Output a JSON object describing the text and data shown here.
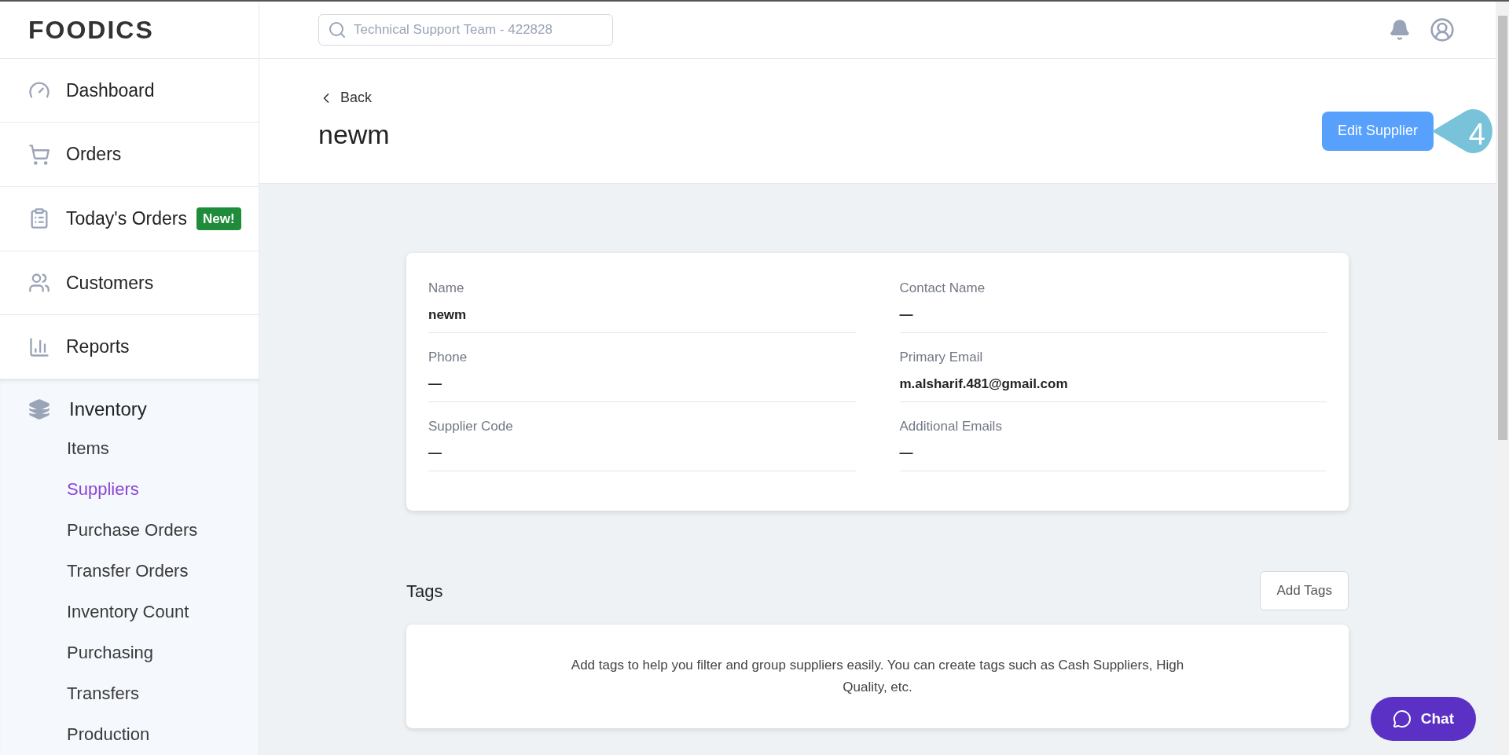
{
  "logo": "FOODICS",
  "search": {
    "placeholder": "Technical Support Team - 422828"
  },
  "nav": [
    {
      "label": "Dashboard"
    },
    {
      "label": "Orders"
    },
    {
      "label": "Today's Orders",
      "badge": "New!"
    },
    {
      "label": "Customers"
    },
    {
      "label": "Reports"
    }
  ],
  "inventory": {
    "label": "Inventory",
    "children": [
      {
        "label": "Items",
        "selected": false
      },
      {
        "label": "Suppliers",
        "selected": true
      },
      {
        "label": "Purchase Orders",
        "selected": false
      },
      {
        "label": "Transfer Orders",
        "selected": false
      },
      {
        "label": "Inventory Count",
        "selected": false
      },
      {
        "label": "Purchasing",
        "selected": false
      },
      {
        "label": "Transfers",
        "selected": false
      },
      {
        "label": "Production",
        "selected": false
      }
    ]
  },
  "back": "Back",
  "title": "newm",
  "edit_button": "Edit Supplier",
  "callout": "4",
  "fields": [
    {
      "label": "Name",
      "value": "newm"
    },
    {
      "label": "Contact Name",
      "value": "—"
    },
    {
      "label": "Phone",
      "value": "—"
    },
    {
      "label": "Primary Email",
      "value": "m.alsharif.481@gmail.com"
    },
    {
      "label": "Supplier Code",
      "value": "—"
    },
    {
      "label": "Additional Emails",
      "value": "—"
    }
  ],
  "tags": {
    "title": "Tags",
    "button": "Add Tags",
    "empty_text": "Add tags to help you filter and group suppliers easily. You can create tags such as Cash Suppliers, High Quality, etc."
  },
  "chat": "Chat"
}
